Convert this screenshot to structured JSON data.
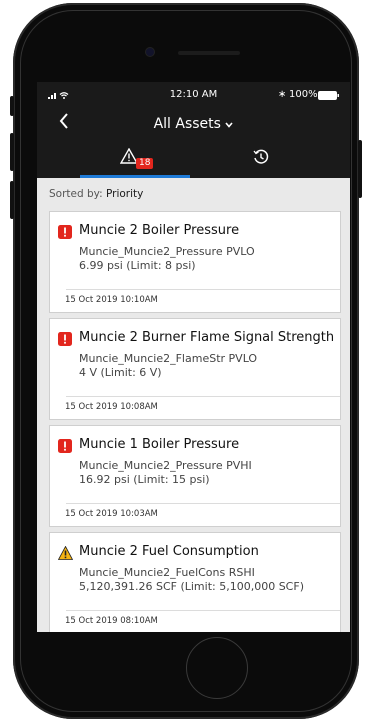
{
  "status_bar": {
    "time": "12:10 AM",
    "battery": "100%"
  },
  "header": {
    "title": "All Assets"
  },
  "tabs": [
    {
      "name": "alarms",
      "badge": "18",
      "active": true
    },
    {
      "name": "history",
      "active": false
    }
  ],
  "sort": {
    "label": "Sorted by:",
    "value": "Priority"
  },
  "alarms": [
    {
      "severity": "critical",
      "title": "Muncie 2 Boiler Pressure",
      "tag": "Muncie_Muncie2_Pressure PVLO",
      "value": "6.99 psi  (Limit: 8 psi)",
      "timestamp": "15 Oct 2019  10:10AM"
    },
    {
      "severity": "critical",
      "title": "Muncie 2 Burner Flame Signal Strength",
      "tag": "Muncie_Muncie2_FlameStr PVLO",
      "value": "4 V (Limit: 6 V)",
      "timestamp": "15 Oct 2019  10:08AM"
    },
    {
      "severity": "critical",
      "title": "Muncie 1 Boiler Pressure",
      "tag": "Muncie_Muncie2_Pressure PVHI",
      "value": "16.92 psi  (Limit: 15 psi)",
      "timestamp": "15 Oct 2019  10:03AM"
    },
    {
      "severity": "warning",
      "title": "Muncie 2 Fuel Consumption",
      "tag": "Muncie_Muncie2_FuelCons RSHI",
      "value": "5,120,391.26 SCF (Limit: 5,100,000 SCF)",
      "timestamp": "15 Oct 2019  08:10AM"
    }
  ],
  "colors": {
    "critical": "#e2261d",
    "warning": "#f5b414",
    "accent": "#1e7ad6",
    "header_bg": "#1a1a1a"
  }
}
